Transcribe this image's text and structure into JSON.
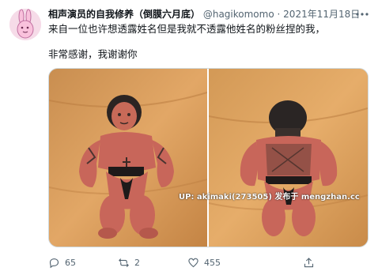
{
  "tweet": {
    "author_name": "相声演员的自我修养（倒膜六月底）",
    "handle": "@hagikomomo",
    "separator": "·",
    "date": "2021年11月18日",
    "more_icon": "more-horizontal-icon",
    "lines": [
      "来自一位也许想透露姓名但是我就不透露他姓名的粉丝捏的我，",
      "非常感谢，我谢谢你"
    ],
    "media": {
      "watermark": "UP: akimaki(273505) 发布于 mengzhan.cc"
    },
    "actions": {
      "reply_count": "65",
      "retweet_count": "2",
      "like_count": "455",
      "reply_icon": "reply-icon",
      "retweet_icon": "retweet-icon",
      "like_icon": "heart-icon",
      "share_icon": "share-icon"
    }
  }
}
